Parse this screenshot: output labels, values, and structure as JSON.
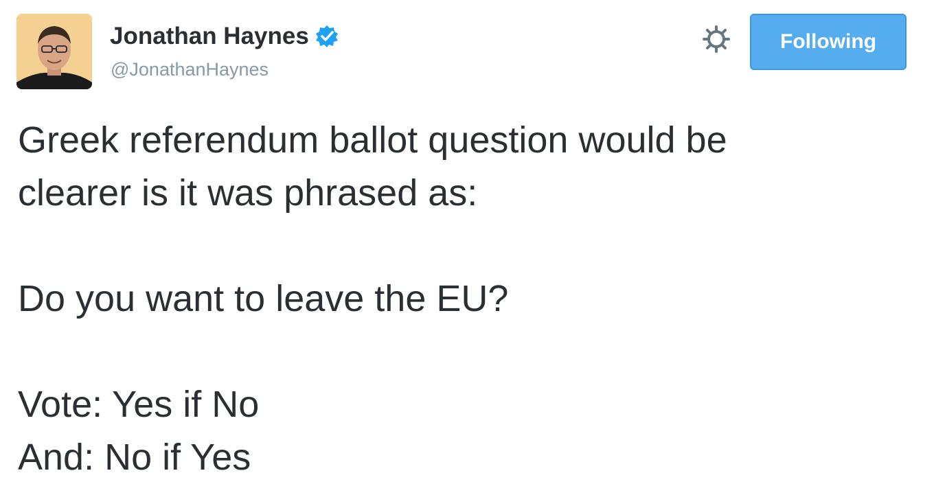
{
  "tweet": {
    "author": {
      "name": "Jonathan Haynes",
      "handle": "@JonathanHaynes",
      "verified": true
    },
    "follow_button_label": "Following",
    "text_lines": [
      "Greek referendum ballot question would be",
      "clearer is it was phrased as:",
      "Do you want to leave the EU?",
      "Vote: Yes if No",
      "And: No if Yes"
    ]
  },
  "icons": {
    "avatar": "avatar-photo",
    "verified": "verified-badge-icon",
    "settings": "gear-icon"
  },
  "colors": {
    "button_blue": "#55acee",
    "verified_blue": "#1da1f2",
    "handle_gray": "#8899a6",
    "text": "#292f33"
  }
}
